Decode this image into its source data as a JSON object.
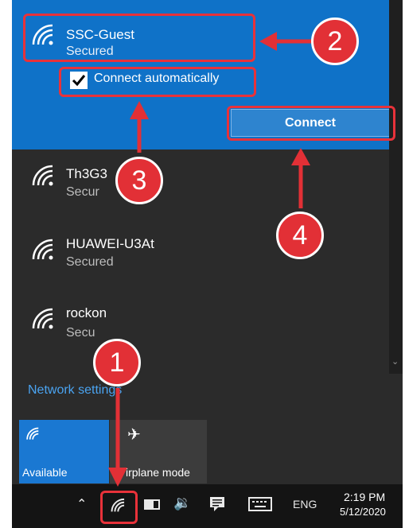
{
  "networks": [
    {
      "name": "SSC-Guest",
      "status": "Secured"
    },
    {
      "name": "Th3G3",
      "status": "Secur"
    },
    {
      "name": "HUAWEI-U3At",
      "status": "Secured"
    },
    {
      "name": "rockon",
      "status": "Secu"
    }
  ],
  "connect_automatically_label": "Connect automatically",
  "connect_automatically_checked": true,
  "connect_button_label": "Connect",
  "network_settings_label": "Network settings",
  "quick_actions": [
    {
      "label": "Available",
      "icon": "wifi-icon",
      "active": true
    },
    {
      "label": "irplane mode",
      "icon": "airplane-icon",
      "active": false
    }
  ],
  "taskbar": {
    "language": "ENG",
    "time": "2:19 PM",
    "date": "5/12/2020"
  },
  "callout_numbers": [
    "1",
    "2",
    "3",
    "4"
  ],
  "colors": {
    "accent": "#0f72c8",
    "panel": "#2b2b2b",
    "callout": "#e23036"
  }
}
